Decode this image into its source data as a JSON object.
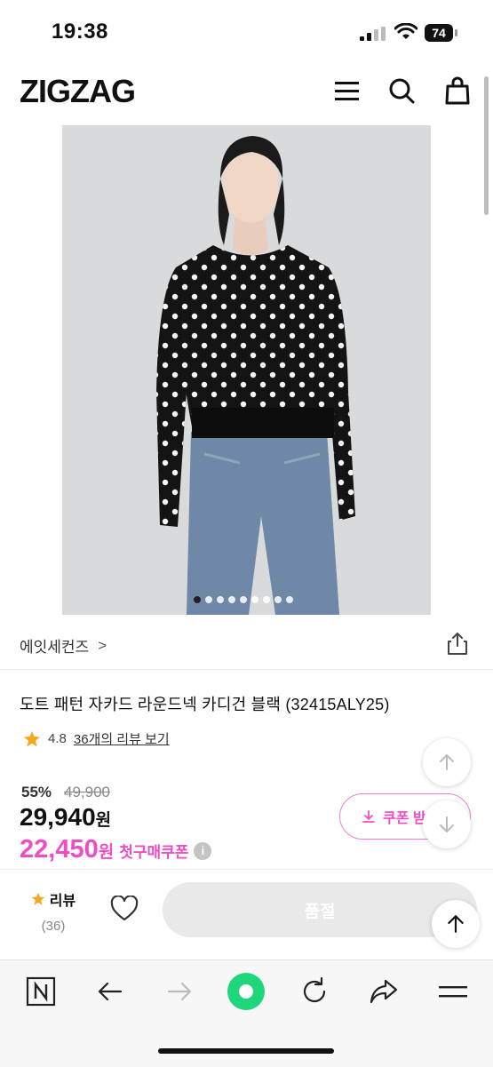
{
  "status": {
    "time": "19:38",
    "battery": "74"
  },
  "header": {
    "logo": "ZIGZAG",
    "icons": [
      "menu-icon",
      "search-icon",
      "shopping-bag-icon"
    ]
  },
  "gallery": {
    "image_count": 9,
    "active_index": 0
  },
  "brand": {
    "name": "에잇세컨즈",
    "chevron": ">"
  },
  "product": {
    "title": "도트 패턴 자카드 라운드넥 카디건 블랙 (32415ALY25)",
    "rating": "4.8",
    "review_link": "36개의 리뷰 보기",
    "discount": "55%",
    "original_price": "49,900",
    "price": "29,940",
    "price_unit": "원",
    "coupon_price": "22,450",
    "coupon_unit": "원",
    "coupon_label": "첫구매쿠폰",
    "info_mark": "i"
  },
  "coupon_button": {
    "label": "쿠폰 받"
  },
  "bottom_bar": {
    "review_label": "리뷰",
    "review_count": "(36)",
    "soldout_label": "품절"
  },
  "colors": {
    "accent": "#f04dc5",
    "star": "#f5a623",
    "soldout_bg": "#e9e9e9"
  }
}
